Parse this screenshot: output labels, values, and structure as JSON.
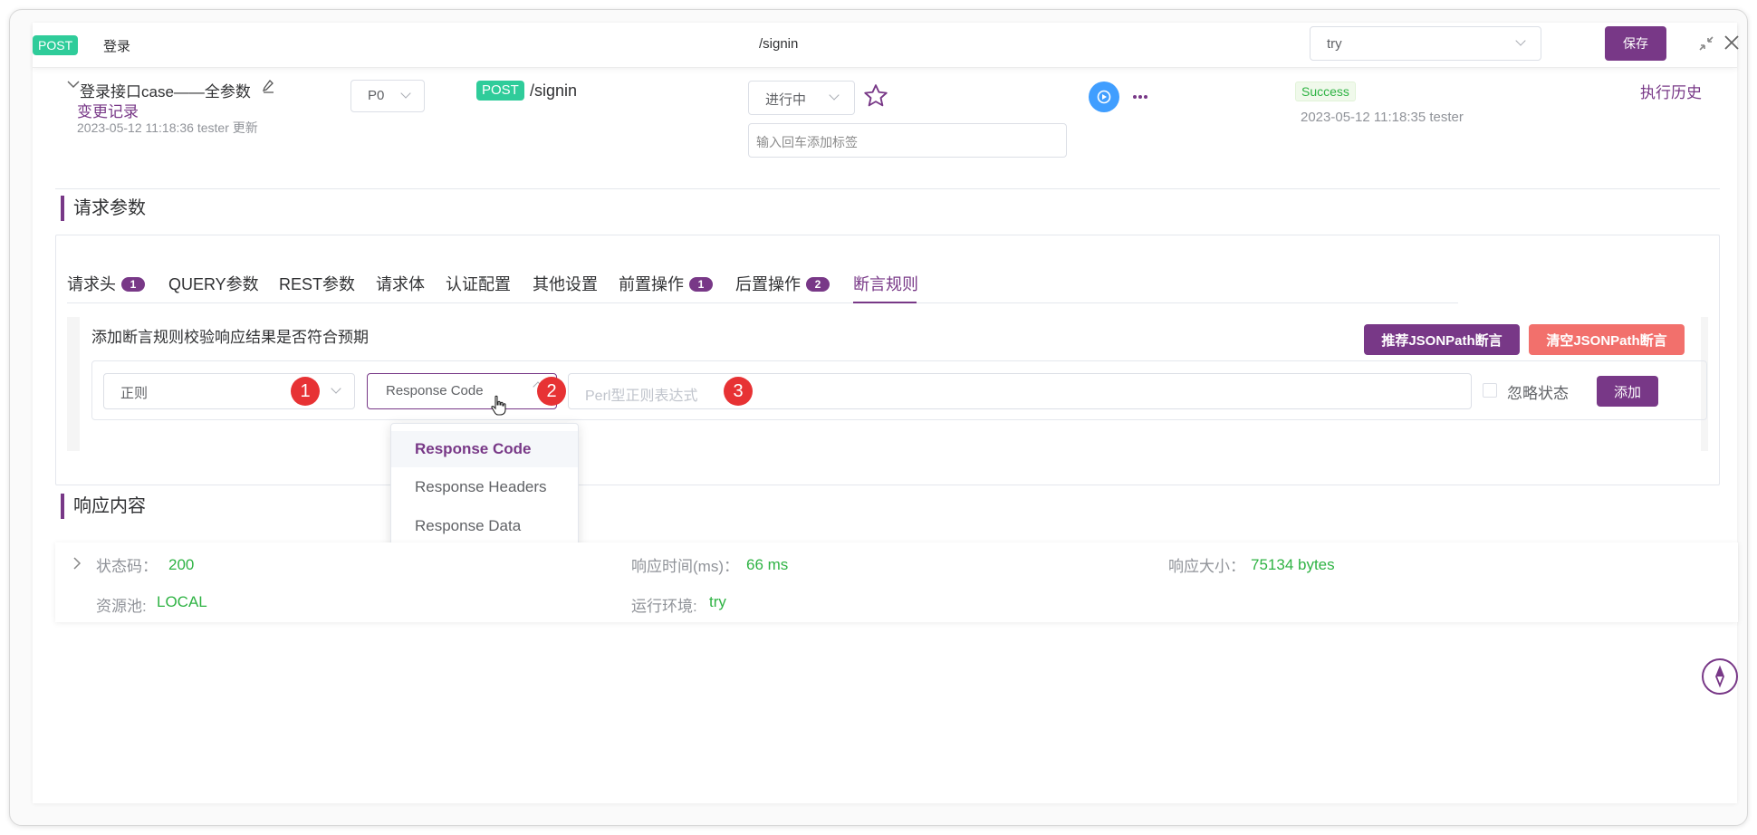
{
  "header": {
    "method": "POST",
    "name": "登录",
    "path": "/signin",
    "env_select": "try",
    "save_label": "保存"
  },
  "case": {
    "title": "登录接口case——全参数",
    "change_log": "变更记录",
    "updated_meta": "2023-05-12 11:18:36 tester 更新",
    "priority": "P0",
    "method": "POST",
    "path": "/signin",
    "status": "进行中",
    "tag_placeholder": "输入回车添加标签",
    "result_badge": "Success",
    "result_meta": "2023-05-12 11:18:35 tester",
    "history_link": "执行历史"
  },
  "request": {
    "section_title": "请求参数",
    "tabs": [
      {
        "label": "请求头",
        "badge": "1"
      },
      {
        "label": "QUERY参数",
        "badge": ""
      },
      {
        "label": "REST参数",
        "badge": ""
      },
      {
        "label": "请求体",
        "badge": ""
      },
      {
        "label": "认证配置",
        "badge": ""
      },
      {
        "label": "其他设置",
        "badge": ""
      },
      {
        "label": "前置操作",
        "badge": "1"
      },
      {
        "label": "后置操作",
        "badge": "2"
      },
      {
        "label": "断言规则",
        "badge": ""
      }
    ],
    "assert_hint": "添加断言规则校验响应结果是否符合预期",
    "recommend_btn": "推荐JSONPath断言",
    "clear_btn": "清空JSONPath断言",
    "rule_type": "正则",
    "subject_select": "Response Code",
    "expr_placeholder": "Perl型正则表达式",
    "ignore_status": "忽略状态",
    "add_btn": "添加",
    "markers": [
      "1",
      "2",
      "3"
    ],
    "dropdown_options": [
      "Response Code",
      "Response Headers",
      "Response Data"
    ]
  },
  "response": {
    "section_title": "响应内容",
    "status_label": "状态码：",
    "status_value": "200",
    "time_label": "响应时间(ms)：",
    "time_value": "66 ms",
    "size_label": "响应大小：",
    "size_value": "75134 bytes",
    "pool_label": "资源池:",
    "pool_value": "LOCAL",
    "env_label": "运行环境:",
    "env_value": "try"
  },
  "colors": {
    "brand": "#783887",
    "post_green": "#2fcc9a",
    "danger": "#e73234",
    "clear_btn": "#f2706c",
    "success": "#2fb344",
    "run_blue": "#409eff"
  }
}
